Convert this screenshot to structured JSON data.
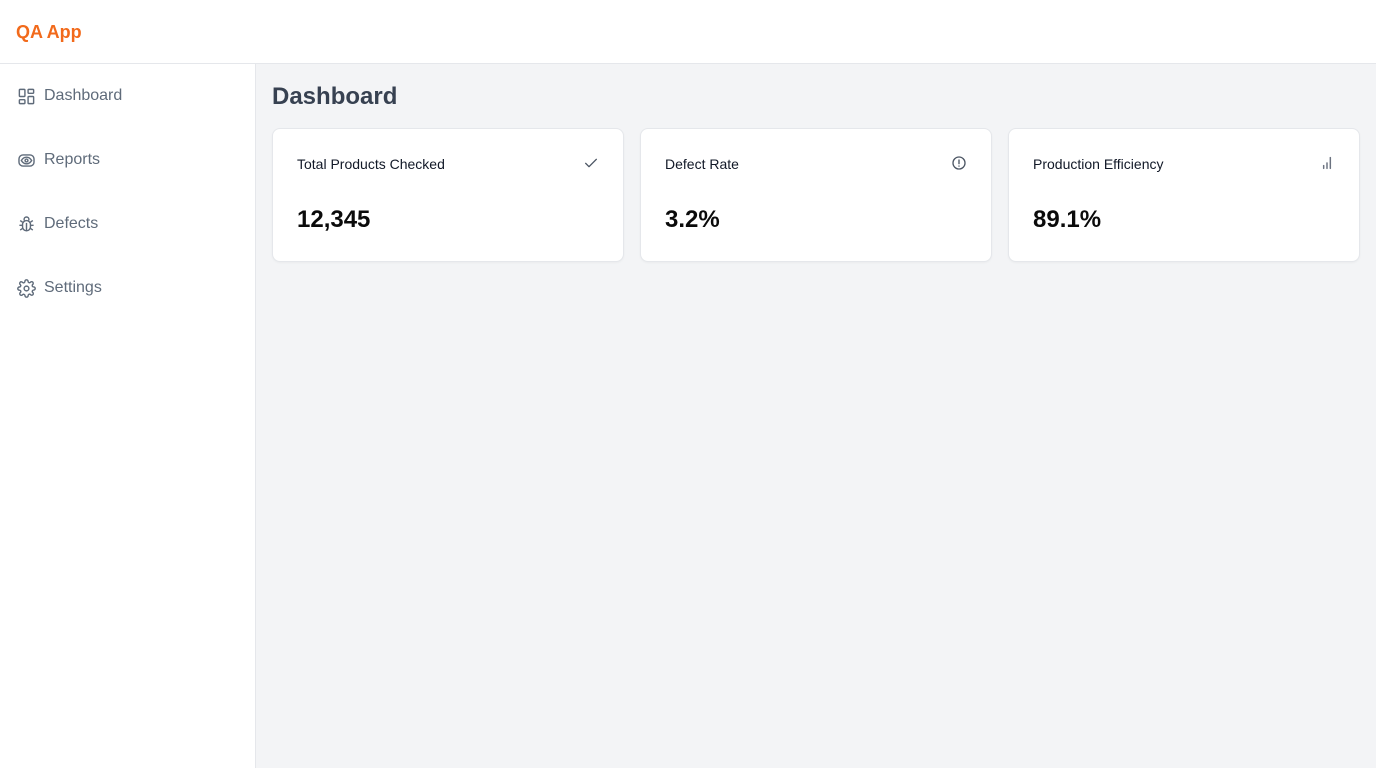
{
  "app": {
    "brand": "QA App",
    "brand_color": "#f26a1b"
  },
  "sidebar": {
    "items": [
      {
        "label": "Dashboard",
        "icon": "dashboard-grid-icon"
      },
      {
        "label": "Reports",
        "icon": "eye-icon"
      },
      {
        "label": "Defects",
        "icon": "bug-icon"
      },
      {
        "label": "Settings",
        "icon": "gear-icon"
      }
    ]
  },
  "main": {
    "title": "Dashboard",
    "cards": [
      {
        "title": "Total Products Checked",
        "value": "12,345",
        "icon": "check-icon"
      },
      {
        "title": "Defect Rate",
        "value": "3.2%",
        "icon": "alert-circle-icon"
      },
      {
        "title": "Production Efficiency",
        "value": "89.1%",
        "icon": "bar-chart-icon"
      }
    ]
  }
}
